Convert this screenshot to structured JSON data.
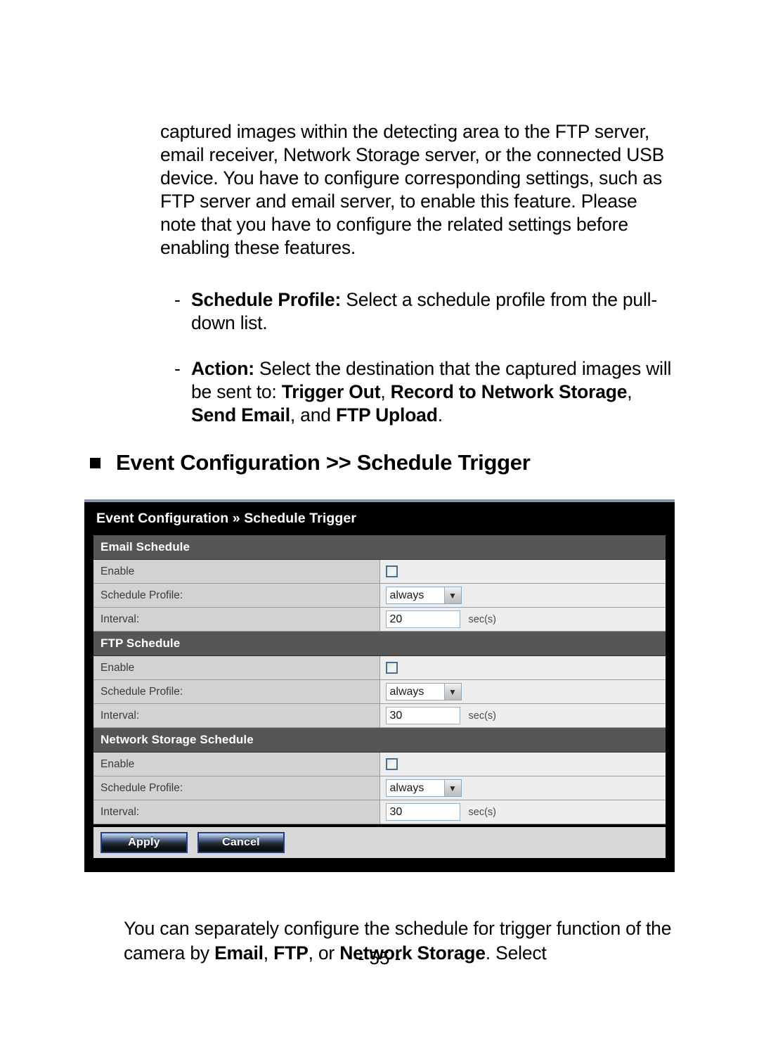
{
  "document": {
    "intro_paragraph": "captured images within the detecting area to the FTP server, email receiver, Network Storage server, or the connected USB device. You have to configure corresponding settings, such as FTP server and email server, to enable this feature. Please note that you have to configure the related settings before enabling these features.",
    "bullets": [
      {
        "marker": "-",
        "term": "Schedule Profile:",
        "text": " Select a schedule profile from the pull-down list."
      },
      {
        "marker": "-",
        "term": "Action:",
        "text_part_1": " Select the destination that the captured images will be sent to: ",
        "bold_1": "Trigger Out",
        "sep_1": ", ",
        "bold_2": "Record to Network Storage",
        "sep_2": ", ",
        "bold_3": "Send Email",
        "sep_3": ", and ",
        "bold_4": "FTP Upload",
        "text_end": "."
      }
    ],
    "section_heading": "Event Configuration >> Schedule Trigger",
    "closing_paragraph_part_1": "You can separately configure the schedule for trigger function of the camera by ",
    "closing_bold_1": "Email",
    "closing_sep_1": ", ",
    "closing_bold_2": "FTP",
    "closing_sep_2": ", or ",
    "closing_bold_3": "Network Storage",
    "closing_end": ". Select",
    "page_number": "- 55 -"
  },
  "screenshot": {
    "title": "Event Configuration » Schedule Trigger",
    "sections": [
      {
        "heading": "Email Schedule",
        "enable_label": "Enable",
        "enable_checked": false,
        "profile_label": "Schedule Profile:",
        "profile_value": "always",
        "interval_label": "Interval:",
        "interval_value": "20",
        "interval_unit": "sec(s)"
      },
      {
        "heading": "FTP Schedule",
        "enable_label": "Enable",
        "enable_checked": false,
        "profile_label": "Schedule Profile:",
        "profile_value": "always",
        "interval_label": "Interval:",
        "interval_value": "30",
        "interval_unit": "sec(s)"
      },
      {
        "heading": "Network Storage Schedule",
        "enable_label": "Enable",
        "enable_checked": false,
        "profile_label": "Schedule Profile:",
        "profile_value": "always",
        "interval_label": "Interval:",
        "interval_value": "30",
        "interval_unit": "sec(s)"
      }
    ],
    "buttons": {
      "apply_label": "Apply",
      "cancel_label": "Cancel"
    },
    "dropdown_arrow_glyph": "▼",
    "colors": {
      "titlebar_bg": "#000000",
      "section_header_bg": "#565656",
      "label_cell_bg": "#d2d2d2",
      "value_cell_bg": "#eeeeee",
      "button_bar_bg": "#d8d8d8",
      "button_border": "#1e3f88",
      "top_accent": "#8b93ad"
    }
  }
}
